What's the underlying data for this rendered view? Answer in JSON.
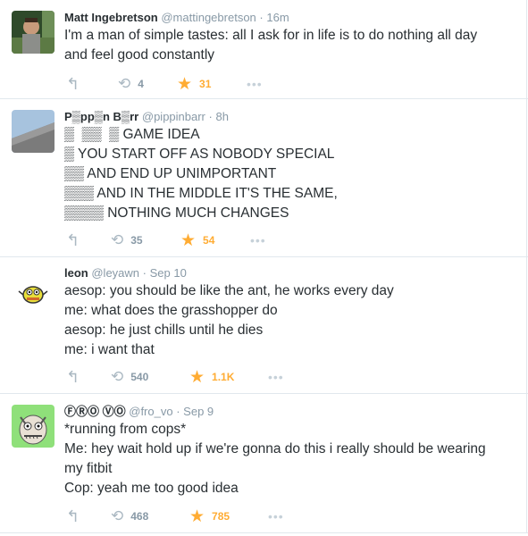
{
  "tweets": [
    {
      "fullname": "Matt Ingebretson",
      "handle": "@mattingebretson",
      "dot": "·",
      "time": "16m",
      "lines": [
        "I'm a man of simple tastes: all I ask for in life is to do nothing all day",
        "and feel good constantly"
      ],
      "retweets": "4",
      "favorites": "31"
    },
    {
      "fullname": "P▒pp▒n B▒rr",
      "handle": "@pippinbarr",
      "dot": "·",
      "time": "8h",
      "lines": [
        "▒  ▒▒  ▒ GAME IDEA",
        "▒ YOU START OFF AS NOBODY SPECIAL",
        "▒▒ AND END UP UNIMPORTANT",
        "▒▒▒ AND IN THE MIDDLE IT'S THE SAME,",
        "▒▒▒▒ NOTHING MUCH CHANGES"
      ],
      "retweets": "35",
      "favorites": "54"
    },
    {
      "fullname": "leon",
      "handle": "@leyawn",
      "dot": "·",
      "time": "Sep 10",
      "lines": [
        "aesop: you should be like the ant, he works every day",
        "me: what does the grasshopper do",
        "aesop: he just chills until he dies",
        "me: i want that"
      ],
      "retweets": "540",
      "favorites": "1.1K"
    },
    {
      "fullname": "ⒻⓇⓄ ⓋⓄ",
      "handle": "@fro_vo",
      "dot": "·",
      "time": "Sep 9",
      "lines": [
        "*running from cops*",
        "Me: hey wait hold up if we're gonna do this i really should be wearing",
        "my fitbit",
        "Cop: yeah me too good idea"
      ],
      "retweets": "468",
      "favorites": "785"
    }
  ],
  "icons": {
    "reply": "↰",
    "retweet": "⟲",
    "favorite": "★",
    "more": "•••"
  },
  "colors": {
    "favorite": "#ffac33",
    "muted": "#8899a6",
    "text": "#292f33",
    "border": "#e1e8ed"
  }
}
